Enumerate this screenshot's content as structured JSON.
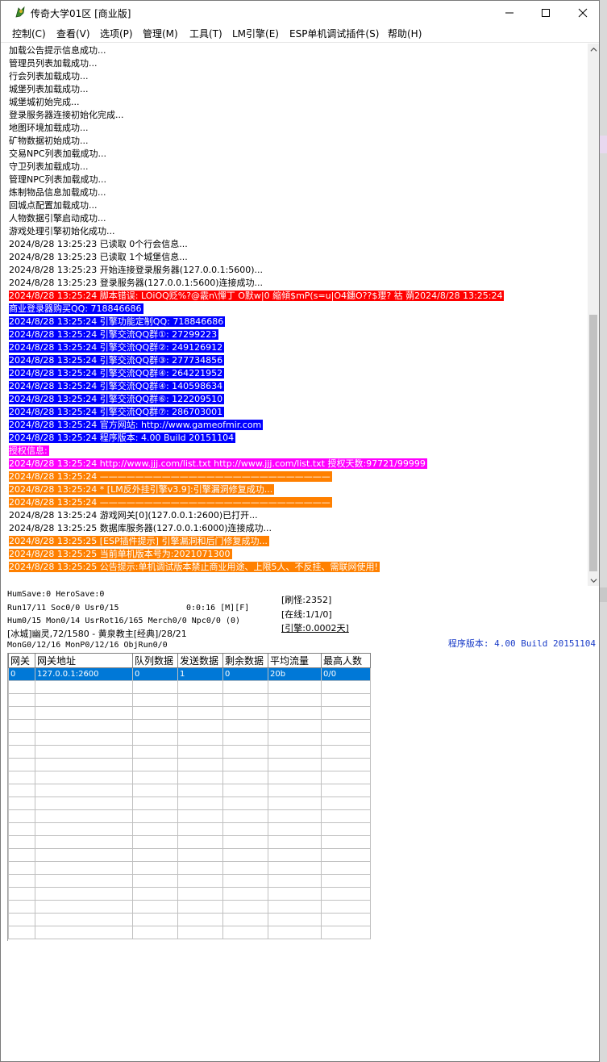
{
  "window": {
    "title": "传奇大学01区 [商业版]",
    "minimize_icon": "minimize-icon",
    "maximize_icon": "maximize-icon",
    "close_icon": "close-icon"
  },
  "menu": [
    {
      "label": "控制(C)"
    },
    {
      "label": "查看(V)"
    },
    {
      "label": "选项(P)"
    },
    {
      "label": "管理(M)"
    },
    {
      "label": "工具(T)"
    },
    {
      "label": "LM引擎(E)"
    },
    {
      "label": "ESP单机调试插件(S)"
    },
    {
      "label": "帮助(H)"
    }
  ],
  "log": [
    {
      "text": "加载公告提示信息成功...",
      "style": "plain"
    },
    {
      "text": "管理员列表加载成功...",
      "style": "plain"
    },
    {
      "text": "行会列表加载成功...",
      "style": "plain"
    },
    {
      "text": "城堡列表加载成功...",
      "style": "plain"
    },
    {
      "text": "城堡城初始完成...",
      "style": "plain"
    },
    {
      "text": "登录服务器连接初始化完成...",
      "style": "plain"
    },
    {
      "text": "地图环境加载成功...",
      "style": "plain"
    },
    {
      "text": "矿物数据初始成功...",
      "style": "plain"
    },
    {
      "text": "交易NPC列表加载成功...",
      "style": "plain"
    },
    {
      "text": "守卫列表加载成功...",
      "style": "plain"
    },
    {
      "text": "管理NPC列表加载成功...",
      "style": "plain"
    },
    {
      "text": "炼制物品信息加载成功...",
      "style": "plain"
    },
    {
      "text": "回城点配置加载成功...",
      "style": "plain"
    },
    {
      "text": "人物数据引擎启动成功...",
      "style": "plain"
    },
    {
      "text": "游戏处理引擎初始化成功...",
      "style": "plain"
    },
    {
      "text": "2024/8/28 13:25:23 已读取 0个行会信息...",
      "style": "plain"
    },
    {
      "text": "2024/8/28 13:25:23 已读取 1个城堡信息...",
      "style": "plain"
    },
    {
      "text": "2024/8/28 13:25:23 开始连接登录服务器(127.0.0.1:5600)...",
      "style": "plain"
    },
    {
      "text": "2024/8/28 13:25:23 登录服务器(127.0.0.1:5600)连接成功...",
      "style": "plain"
    },
    {
      "text": "2024/8/28 13:25:24 脚本错误: LOiOQ贬%?@霰n\\憚丁 O默w|0 縮傾$mP(s=u|O4鏸O??$瓔? 祜        蒴2024/8/28 13:25:24",
      "style": "red"
    },
    {
      "text": "商业登录器购买QQ: 718846686",
      "style": "blue"
    },
    {
      "text": "2024/8/28 13:25:24 引擎功能定制QQ: 718846686",
      "style": "blue"
    },
    {
      "text": "2024/8/28 13:25:24 引擎交流QQ群①: 27299223",
      "style": "blue"
    },
    {
      "text": "2024/8/28 13:25:24 引擎交流QQ群②: 249126912",
      "style": "blue"
    },
    {
      "text": "2024/8/28 13:25:24 引擎交流QQ群③: 277734856",
      "style": "blue"
    },
    {
      "text": "2024/8/28 13:25:24 引擎交流QQ群④: 264221952",
      "style": "blue"
    },
    {
      "text": "2024/8/28 13:25:24 引擎交流QQ群④: 140598634",
      "style": "blue"
    },
    {
      "text": "2024/8/28 13:25:24 引擎交流QQ群⑥: 122209510",
      "style": "blue"
    },
    {
      "text": "2024/8/28 13:25:24 引擎交流QQ群⑦: 286703001",
      "style": "blue"
    },
    {
      "text": "2024/8/28 13:25:24 官方网站: http://www.gameofmir.com",
      "style": "blue"
    },
    {
      "text": "2024/8/28 13:25:24 程序版本: 4.00 Build 20151104",
      "style": "blue"
    },
    {
      "text": "授权信息:",
      "style": "mag"
    },
    {
      "text": "2024/8/28 13:25:24 http://www.jjj.com/list.txt http://www.jjj.com/list.txt 授权天数:97721/99999",
      "style": "mag"
    },
    {
      "text": "2024/8/28 13:25:24 ——————————————————————————",
      "style": "ora"
    },
    {
      "text": "2024/8/28 13:25:24 * [LM反外挂引擎v3.9]:引擎漏洞修复成功...",
      "style": "ora"
    },
    {
      "text": "2024/8/28 13:25:24 ——————————————————————————",
      "style": "ora"
    },
    {
      "text": "2024/8/28 13:25:24 游戏网关[0](127.0.0.1:2600)已打开...",
      "style": "plain"
    },
    {
      "text": "2024/8/28 13:25:25 数据库服务器(127.0.0.1:6000)连接成功...",
      "style": "plain"
    },
    {
      "text": "2024/8/28 13:25:25 [ESP插件提示] 引擎漏洞和后门修复成功...",
      "style": "ora"
    },
    {
      "text": "2024/8/28 13:25:25 当前单机版本号为:2021071300",
      "style": "ora"
    },
    {
      "text": "2024/8/28 13:25:25 公告提示:单机调试版本禁止商业用途、上限5人、不反挂、需联网使用!",
      "style": "ora"
    }
  ],
  "status": {
    "line1": "HumSave:0 HeroSave:0",
    "line2a": "Run17/11 Soc0/0 Usr0/15",
    "line2b": "0:0:16 [M][F]",
    "line3": "Hum0/15 Mon0/14 UsrRot16/165 Merch0/0 Npc0/0 (0)",
    "line4": "[冰城]幽灵,72/1580 - 黄泉教主[经典]/28/21",
    "line5": "MonG0/12/16 MonP0/12/16 ObjRun0/0",
    "refresh": "[刷怪:2352]",
    "online": "[在线:1/1/0]",
    "engine": "[引擎:0.0002天]",
    "version": "程序版本: 4.00 Build 20151104"
  },
  "gateway_table": {
    "columns": [
      "网关",
      "网关地址",
      "队列数据",
      "发送数据",
      "剩余数据",
      "平均流量",
      "最高人数"
    ],
    "rows": [
      [
        "0",
        "127.0.0.1:2600",
        "0",
        "1",
        "0",
        "20b",
        "0/0"
      ]
    ],
    "empty_rows": 20
  },
  "colors": {
    "red": "#ff0000",
    "blue": "#0000ff",
    "magenta": "#ff00ff",
    "orange": "#ff8000",
    "selection": "#0078d7",
    "version_text": "#1a3cc8"
  }
}
